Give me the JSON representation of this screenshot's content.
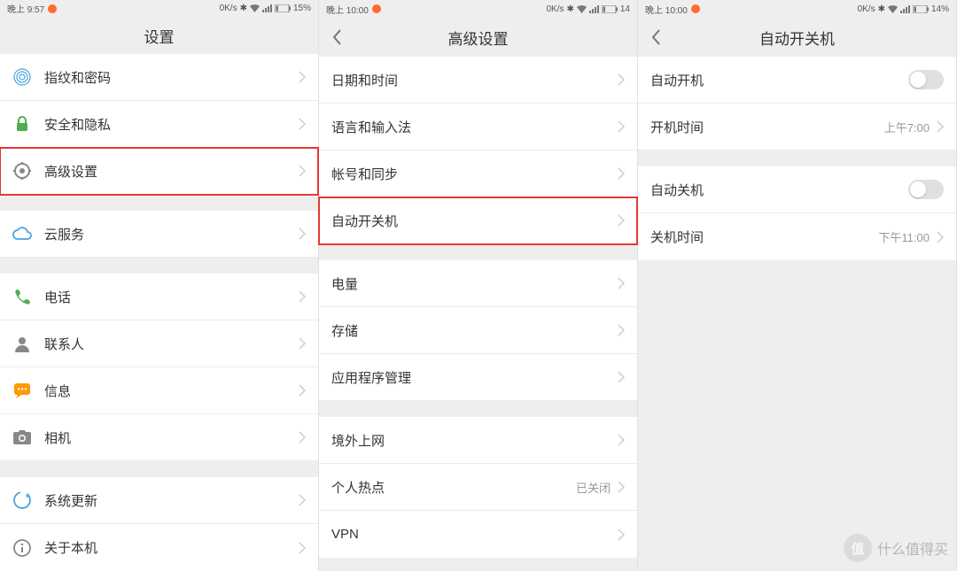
{
  "panel1": {
    "status": {
      "time": "晚上 9:57",
      "speed": "0K/s",
      "battery": "15%"
    },
    "title": "设置",
    "groups": [
      [
        {
          "icon": "fingerprint",
          "label": "指纹和密码"
        },
        {
          "icon": "lock",
          "label": "安全和隐私"
        },
        {
          "icon": "gear",
          "label": "高级设置",
          "highlight": true
        }
      ],
      [
        {
          "icon": "cloud",
          "label": "云服务"
        }
      ],
      [
        {
          "icon": "phone",
          "label": "电话"
        },
        {
          "icon": "contact",
          "label": "联系人"
        },
        {
          "icon": "message",
          "label": "信息"
        },
        {
          "icon": "camera",
          "label": "相机"
        }
      ],
      [
        {
          "icon": "update",
          "label": "系统更新"
        },
        {
          "icon": "about",
          "label": "关于本机"
        }
      ]
    ]
  },
  "panel2": {
    "status": {
      "time": "晚上 10:00",
      "speed": "0K/s",
      "battery": "14"
    },
    "title": "高级设置",
    "groups": [
      [
        {
          "label": "日期和时间"
        },
        {
          "label": "语言和输入法"
        },
        {
          "label": "帐号和同步"
        },
        {
          "label": "自动开关机",
          "highlight": true
        }
      ],
      [
        {
          "label": "电量"
        },
        {
          "label": "存储"
        },
        {
          "label": "应用程序管理"
        }
      ],
      [
        {
          "label": "境外上网"
        },
        {
          "label": "个人热点",
          "value": "已关闭"
        },
        {
          "label": "VPN"
        }
      ]
    ]
  },
  "panel3": {
    "status": {
      "time": "晚上 10:00",
      "speed": "0K/s",
      "battery": "14%"
    },
    "title": "自动开关机",
    "groups": [
      [
        {
          "label": "自动开机",
          "toggle": true
        },
        {
          "label": "开机时间",
          "value": "上午7:00"
        }
      ],
      [
        {
          "label": "自动关机",
          "toggle": true
        },
        {
          "label": "关机时间",
          "value": "下午11:00"
        }
      ]
    ]
  },
  "watermark": "什么值得买"
}
